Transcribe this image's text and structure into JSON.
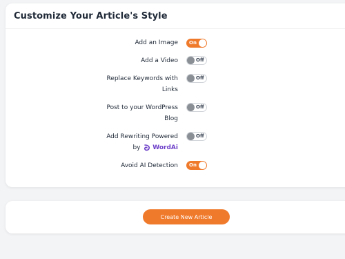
{
  "card": {
    "title": "Customize Your Article's Style"
  },
  "options": [
    {
      "label": "Add an Image",
      "state": "On",
      "enabled": true
    },
    {
      "label": "Add a Video",
      "state": "Off",
      "enabled": false
    },
    {
      "label_line1": "Replace Keywords with",
      "label_line2": "Links",
      "state": "Off",
      "enabled": false
    },
    {
      "label_line1": "Post to your WordPress",
      "label_line2": "Blog",
      "state": "Off",
      "enabled": false
    },
    {
      "label_line1": "Add Rewriting Powered",
      "label_by": "by",
      "brand": "WordAi",
      "state": "Off",
      "enabled": false
    },
    {
      "label": "Avoid AI Detection",
      "state": "On",
      "enabled": true
    }
  ],
  "actions": {
    "create_label": "Create New Article"
  },
  "colors": {
    "accent": "#f07a2c",
    "toggle_off_knob": "#8a8f96",
    "wordai_brand": "#6d3fc9"
  },
  "icons": {
    "wordai": "wordai-logo-icon"
  }
}
